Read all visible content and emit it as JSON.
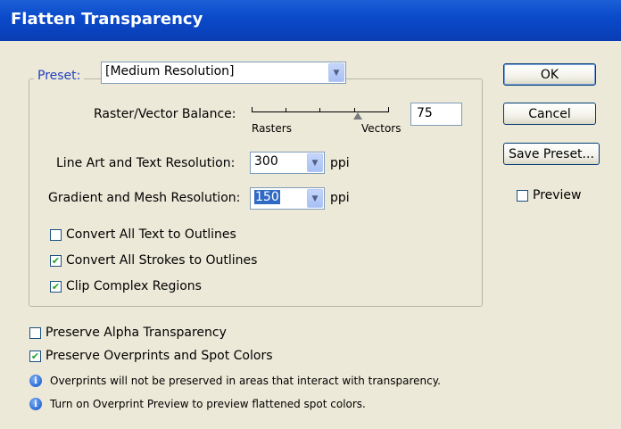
{
  "window": {
    "title": "Flatten Transparency"
  },
  "preset": {
    "label": "Preset:",
    "value": "[Medium Resolution]"
  },
  "raster_vector": {
    "label": "Raster/Vector Balance:",
    "min_label": "Rasters",
    "max_label": "Vectors",
    "value": "75",
    "slider_fraction": 0.75
  },
  "line_art": {
    "label": "Line Art and Text Resolution:",
    "value": "300",
    "unit": "ppi"
  },
  "gradient": {
    "label": "Gradient and Mesh Resolution:",
    "value": "150",
    "unit": "ppi"
  },
  "checkboxes": [
    {
      "label": "Convert All Text to Outlines",
      "checked": false
    },
    {
      "label": "Convert All Strokes to Outlines",
      "checked": true
    },
    {
      "label": "Clip Complex Regions",
      "checked": true
    }
  ],
  "preserve": [
    {
      "label": "Preserve Alpha Transparency",
      "checked": false
    },
    {
      "label": "Preserve Overprints and Spot Colors",
      "checked": true
    }
  ],
  "notes": [
    "Overprints will not be preserved in areas that interact with transparency.",
    "Turn on Overprint Preview to preview flattened spot colors."
  ],
  "buttons": {
    "ok": "OK",
    "cancel": "Cancel",
    "save_preset": "Save Preset..."
  },
  "preview": {
    "label": "Preview",
    "checked": false
  },
  "colors": {
    "title_bar": "#0a49c9",
    "dialog_bg": "#ece9d8",
    "check_mark": "#21a121"
  },
  "icons": {
    "info": "info-icon",
    "dropdown": "chevron-down-icon"
  }
}
